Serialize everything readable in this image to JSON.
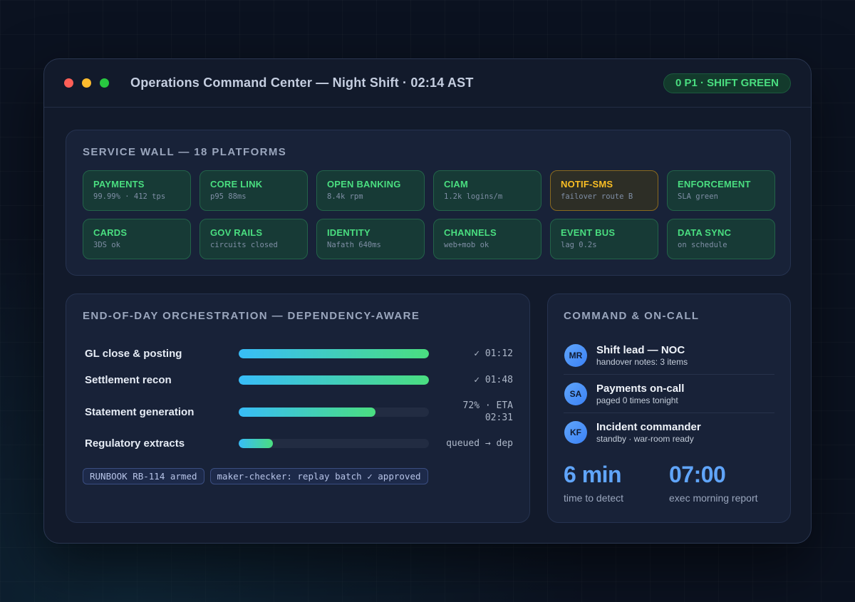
{
  "window": {
    "title": "Operations Command Center — Night Shift · 02:14 AST",
    "status_pill": "0 P1 · SHIFT GREEN"
  },
  "service_wall": {
    "title": "SERVICE WALL — 18 PLATFORMS",
    "tiles": [
      {
        "name": "PAYMENTS",
        "metric": "99.99% · 412 tps",
        "state": "ok"
      },
      {
        "name": "CORE LINK",
        "metric": "p95 88ms",
        "state": "ok"
      },
      {
        "name": "OPEN BANKING",
        "metric": "8.4k rpm",
        "state": "ok"
      },
      {
        "name": "CIAM",
        "metric": "1.2k logins/m",
        "state": "ok"
      },
      {
        "name": "NOTIF-SMS",
        "metric": "failover route B",
        "state": "warn"
      },
      {
        "name": "ENFORCEMENT",
        "metric": "SLA green",
        "state": "ok"
      },
      {
        "name": "CARDS",
        "metric": "3DS ok",
        "state": "ok"
      },
      {
        "name": "GOV RAILS",
        "metric": "circuits closed",
        "state": "ok"
      },
      {
        "name": "IDENTITY",
        "metric": "Nafath 640ms",
        "state": "ok"
      },
      {
        "name": "CHANNELS",
        "metric": "web+mob ok",
        "state": "ok"
      },
      {
        "name": "EVENT BUS",
        "metric": "lag 0.2s",
        "state": "ok"
      },
      {
        "name": "DATA SYNC",
        "metric": "on schedule",
        "state": "ok"
      }
    ]
  },
  "orchestration": {
    "title": "END-OF-DAY ORCHESTRATION — DEPENDENCY-AWARE",
    "jobs": [
      {
        "name": "GL close & posting",
        "progress": 1.0,
        "status": "✓ 01:12"
      },
      {
        "name": "Settlement recon",
        "progress": 1.0,
        "status": "✓ 01:48"
      },
      {
        "name": "Statement generation",
        "progress": 0.72,
        "status_line1": "72% · ETA",
        "status_line2": "02:31"
      },
      {
        "name": "Regulatory extracts",
        "progress": 0.18,
        "status": "queued → dep"
      }
    ],
    "chips": [
      "RUNBOOK RB-114 armed",
      "maker-checker: replay batch ✓ approved"
    ]
  },
  "oncall": {
    "title": "COMMAND & ON-CALL",
    "people": [
      {
        "initials": "MR",
        "role": "Shift lead — NOC",
        "note": "handover notes: 3 items"
      },
      {
        "initials": "SA",
        "role": "Payments on-call",
        "note": "paged 0 times tonight"
      },
      {
        "initials": "KF",
        "role": "Incident commander",
        "note": "standby · war-room ready"
      }
    ],
    "kpis": [
      {
        "value": "6 min",
        "label": "time to detect"
      },
      {
        "value": "07:00",
        "label": "exec morning report"
      }
    ]
  },
  "colors": {
    "ok": "#4ade80",
    "warn": "#fbbf24",
    "accent": "#60a5fa"
  }
}
